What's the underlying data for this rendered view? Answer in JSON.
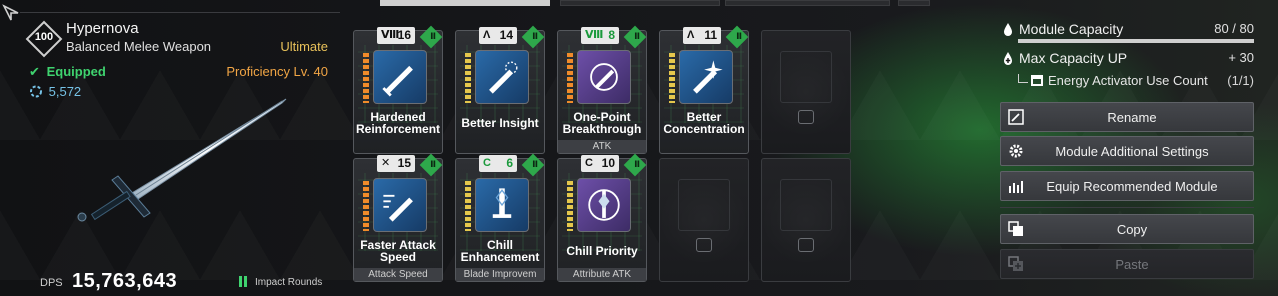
{
  "weapon": {
    "level": "100",
    "name": "Hypernova",
    "type": "Balanced Melee Weapon",
    "tier": "Ultimate",
    "equipped_label": "Equipped",
    "proficiency": "Proficiency Lv. 40",
    "power": "5,572",
    "dps_label": "DPS",
    "dps_value": "15,763,643",
    "ammo_label": "Impact Rounds"
  },
  "modules": [
    {
      "capacity": "16",
      "polarity": "Ⅷ",
      "name": "Hardened Reinforcement",
      "sub": "",
      "color": "orange",
      "cap_green": false,
      "stack_color": "orange",
      "icon": "sword-shield-icon"
    },
    {
      "capacity": "14",
      "polarity": "Λ",
      "name": "Better Insight",
      "sub": "",
      "color": "orange",
      "cap_green": false,
      "stack_color": "yellow",
      "icon": "sword-burst-icon"
    },
    {
      "capacity": "8",
      "polarity": "Ⅷ",
      "name": "One-Point Breakthrough",
      "sub": "ATK",
      "color": "purple",
      "cap_green": true,
      "stack_color": "orange",
      "icon": "sword-cycle-icon"
    },
    {
      "capacity": "11",
      "polarity": "Λ",
      "name": "Better Concentration",
      "sub": "",
      "color": "orange",
      "cap_green": false,
      "stack_color": "yellow",
      "icon": "sword-flare-icon"
    },
    {
      "capacity": "15",
      "polarity": "✕",
      "name": "Faster Attack Speed",
      "sub": "Attack Speed",
      "color": "orange",
      "cap_green": false,
      "stack_color": "orange",
      "icon": "sword-speed-icon"
    },
    {
      "capacity": "6",
      "polarity": "C",
      "name": "Chill Enhancement",
      "sub": "Blade Improvem",
      "color": "orange",
      "cap_green": true,
      "stack_color": "yellow",
      "icon": "sword-frost-icon"
    },
    {
      "capacity": "10",
      "polarity": "C",
      "name": "Chill Priority",
      "sub": "Attribute ATK",
      "color": "purple",
      "cap_green": false,
      "stack_color": "yellow",
      "icon": "sword-crystal-icon"
    }
  ],
  "capacity": {
    "label": "Module Capacity",
    "value": "80 / 80",
    "fill": 1.0,
    "max_up_label": "Max Capacity UP",
    "max_up_value": "+ 30",
    "activator_label": "Energy Activator Use Count",
    "activator_value": "(1/1)"
  },
  "buttons": {
    "rename": "Rename",
    "additional": "Module Additional Settings",
    "recommended": "Equip Recommended Module",
    "copy": "Copy",
    "paste": "Paste"
  },
  "colors": {
    "equipped": "#3fd36f",
    "tier": "#e8c15a",
    "proficiency": "#f1a545",
    "power": "#76c2e6",
    "module_tier_badge": "#2ea84b"
  }
}
